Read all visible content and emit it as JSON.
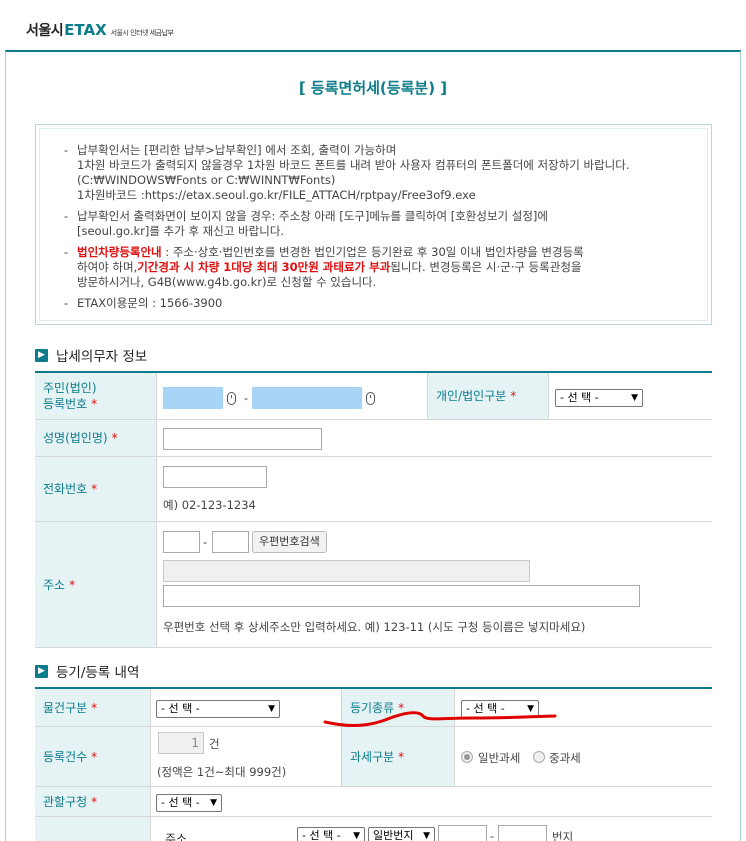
{
  "header": {
    "logo_city": "서울시",
    "logo_etax": "ETAX",
    "logo_sub": "서울시 인터넷 세금납부"
  },
  "page_title": "[ 등록면허세(등록분) ]",
  "notice": {
    "item1": [
      "납부확인서는 [편리한 납부>납부확인] 에서 조회, 출력이 가능하며",
      "1차원 바코드가 출력되지 않을경우 1차원 바코드 폰트를 내려 받아 사용자 컴퓨터의 폰트폴더에 저장하기 바랍니다.",
      "(C:₩WINDOWS₩Fonts or C:₩WINNT₩Fonts)",
      "1차원바코드 :https://etax.seoul.go.kr/FILE_ATTACH/rptpay/Free3of9.exe"
    ],
    "item2": [
      "납부확인서 출력화면이 보이지 않을 경우: 주소창 아래 [도구]메뉴를 클릭하여 [호환성보기 설정]에",
      "[seoul.go.kr]를 추가 후 재신고 바랍니다."
    ],
    "item3_red1": "법인차량등록안내",
    "item3_l1": " : 주소·상호·법인번호를 변경한 법인기업은 등기완료 후 30일 이내 법인차량을 변경등록",
    "item3_l2a": "하여야 하며,",
    "item3_red2": "기간경과 시 차량 1대당 최대 30만원 과태료가 부과",
    "item3_l2b": "됩니다. 변경등록은 시·군·구 등록관청을",
    "item3_l3": "방문하시거나, G4B(www.g4b.go.kr)로 신청할 수 있습니다.",
    "item4": "ETAX이용문의 : 1566-3900"
  },
  "section1": {
    "title": "납세의무자 정보",
    "id_label_1": "주민(법인)",
    "id_label_2": "등록번호",
    "id_dash": "-",
    "type_label": "개인/법인구분",
    "select_placeholder": "- 선 택 -",
    "name_label": "성명(법인명)",
    "phone_label": "전화번호",
    "phone_example": "예) 02-123-1234",
    "address_label": "주소",
    "zip_dash": "-",
    "zip_search_button": "우편번호검색",
    "address_hint": "우편번호 선택 후 상세주소만 입력하세요. 예) 123-11 (시도 구청 등이름은 넣지마세요)",
    "required_mark": "*"
  },
  "section2": {
    "title": "등기/등록 내역",
    "item_type_label": "물건구분",
    "item_type_value": "- 선 택 -",
    "reg_type_label": "등기종류",
    "reg_type_value": "- 선 택 -",
    "count_label": "등록건수",
    "count_value": "1",
    "count_unit": "건",
    "count_note": "(정액은 1건~최대 999건)",
    "tax_type_label": "과세구분",
    "tax_normal": "일반과세",
    "tax_heavy": "중과세",
    "office_label": "관할구청",
    "office_value": "- 선 택 -",
    "sub_address_label": "주소",
    "sub_select1": "- 선 택 -",
    "sub_select2": "일반번지",
    "sub_dash": "-",
    "sub_unit": "번지"
  }
}
